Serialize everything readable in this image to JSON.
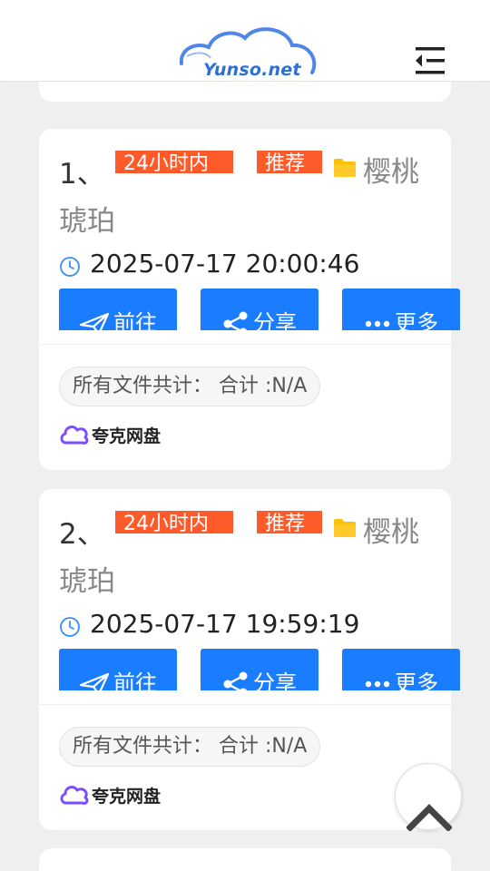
{
  "header": {
    "logo_text": "Yunso.net",
    "menu_icon": "menu-collapse-icon"
  },
  "results": [
    {
      "index": "1、",
      "badge_time": "24小时内",
      "badge_recommend": "推荐",
      "title_line1": "樱桃",
      "title_line2": "琥珀",
      "time": "2025-07-17 20:00:46",
      "buttons": {
        "go": "前往",
        "share": "分享",
        "more": "更多"
      },
      "total": "所有文件共计：  合计 :N/A",
      "source": "夸克网盘"
    },
    {
      "index": "2、",
      "badge_time": "24小时内",
      "badge_recommend": "推荐",
      "title_line1": "樱桃",
      "title_line2": "琥珀",
      "time": "2025-07-17 19:59:19",
      "buttons": {
        "go": "前往",
        "share": "分享",
        "more": "更多"
      },
      "total": "所有文件共计：  合计 :N/A",
      "source": "夸克网盘"
    }
  ],
  "colors": {
    "accent_blue": "#1a7dff",
    "badge_orange": "#ff5a2a",
    "folder_yellow": "#ffc107",
    "quark_purple": "#7b4dff"
  },
  "back_to_top_icon": "chevron-up-icon"
}
